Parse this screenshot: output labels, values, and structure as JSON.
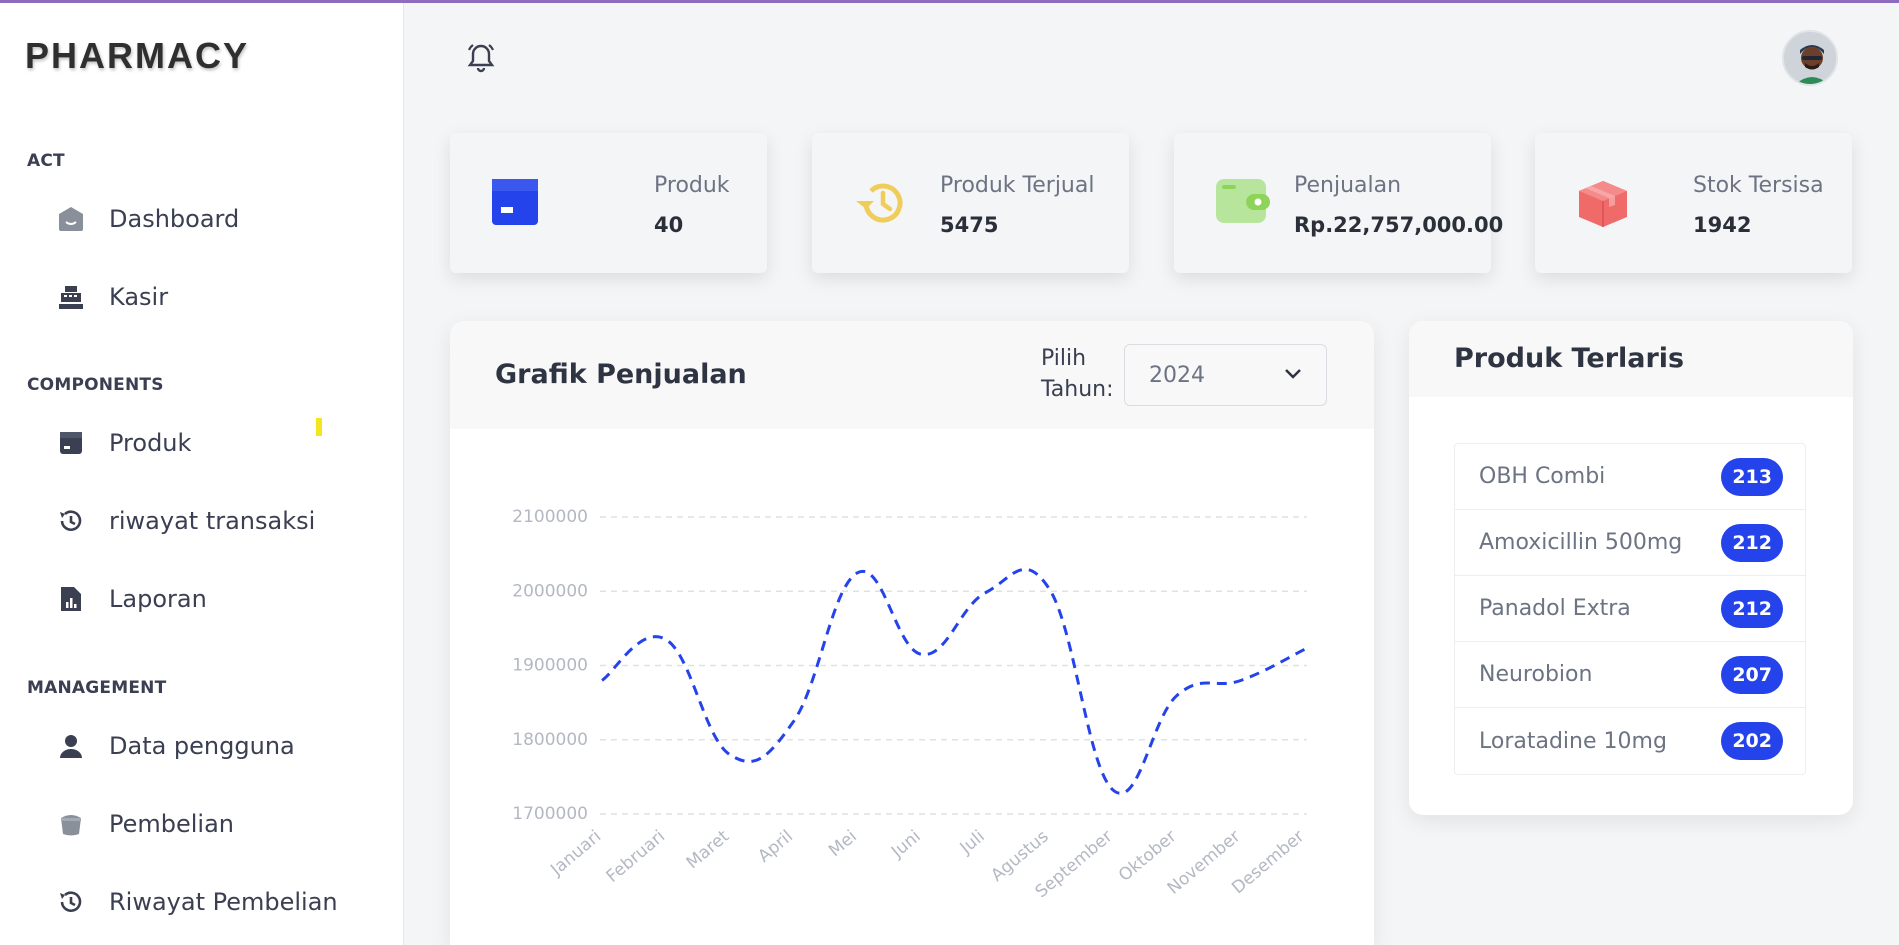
{
  "brand": "PHARMACY",
  "sidebar": {
    "sections": [
      {
        "title": "ACT"
      },
      {
        "title": "COMPONENTS"
      },
      {
        "title": "MANAGEMENT"
      }
    ],
    "items": [
      {
        "label": "Dashboard",
        "icon": "home-icon"
      },
      {
        "label": "Kasir",
        "icon": "cash-register-icon"
      },
      {
        "label": "Produk",
        "icon": "box-icon"
      },
      {
        "label": "riwayat transaksi",
        "icon": "history-icon"
      },
      {
        "label": "Laporan",
        "icon": "report-icon"
      },
      {
        "label": "Data pengguna",
        "icon": "user-icon"
      },
      {
        "label": "Pembelian",
        "icon": "basket-icon"
      },
      {
        "label": "Riwayat Pembelian",
        "icon": "history-icon"
      }
    ]
  },
  "stats": [
    {
      "title": "Produk",
      "value": "40",
      "icon": "box-icon",
      "color": "#2543ea"
    },
    {
      "title": "Produk Terjual",
      "value": "5475",
      "icon": "history-icon",
      "color": "#f0cd5a"
    },
    {
      "title": "Penjualan",
      "value": "Rp.22,757,000.00",
      "icon": "wallet-icon",
      "color": "#8fd45a"
    },
    {
      "title": "Stok Tersisa",
      "value": "1942",
      "icon": "package-icon",
      "color": "#f06a6a"
    }
  ],
  "chart": {
    "title": "Grafik Penjualan",
    "year_label": "Pilih Tahun:",
    "year_value": "2024"
  },
  "chart_data": {
    "type": "line",
    "categories": [
      "Januari",
      "Februari",
      "Maret",
      "April",
      "Mei",
      "Juni",
      "Juli",
      "Agustus",
      "September",
      "Oktober",
      "November",
      "Desember"
    ],
    "series": [
      {
        "values": [
          1880000,
          1935000,
          1780000,
          1825000,
          2025000,
          1915000,
          1998000,
          2003000,
          1732000,
          1860000,
          1880000,
          1922000
        ]
      }
    ],
    "yticks": [
      1700000,
      1800000,
      1900000,
      2000000,
      2100000
    ],
    "ylim": [
      1700000,
      2100000
    ],
    "grid": true,
    "line_color": "#2543ea",
    "line_style": "dashed"
  },
  "best_sellers": {
    "title": "Produk Terlaris",
    "items": [
      {
        "name": "OBH Combi",
        "count": "213"
      },
      {
        "name": "Amoxicillin 500mg",
        "count": "212"
      },
      {
        "name": "Panadol Extra",
        "count": "212"
      },
      {
        "name": "Neurobion",
        "count": "207"
      },
      {
        "name": "Loratadine 10mg",
        "count": "202"
      }
    ]
  },
  "colors": {
    "accent": "#2543ea",
    "top_border": "#8e6bbf"
  }
}
